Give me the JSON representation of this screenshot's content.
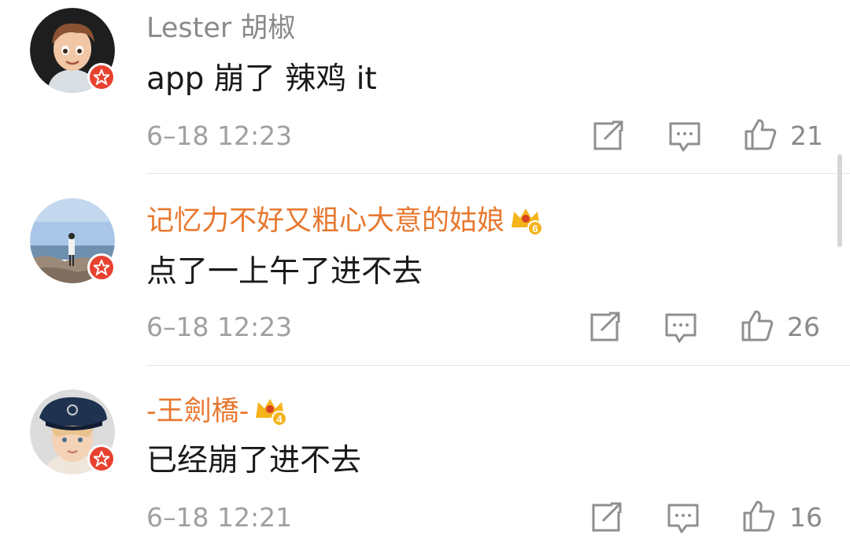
{
  "comments": [
    {
      "username": "Lester 胡椒",
      "vip": false,
      "text": "app 崩了 辣鸡 it",
      "time": "6–18 12:23",
      "likes": "21",
      "avatar_icon": "memoji-avatar"
    },
    {
      "username": "记忆力不好又粗心大意的姑娘",
      "vip": true,
      "crown_level": "6",
      "text": "点了一上午了进不去",
      "time": "6–18 12:23",
      "likes": "26",
      "avatar_icon": "beach-photo-avatar"
    },
    {
      "username": "-王劍橋-",
      "vip": true,
      "crown_level": "4",
      "text": "已经崩了进不去",
      "time": "6–18 12:21",
      "likes": "16",
      "avatar_icon": "child-captain-hat-avatar"
    }
  ],
  "colors": {
    "vip_name": "#e8782f",
    "plain_name": "#8a8a8a",
    "badge_red": "#e8412f",
    "crown_gold": "#f5b31b"
  }
}
